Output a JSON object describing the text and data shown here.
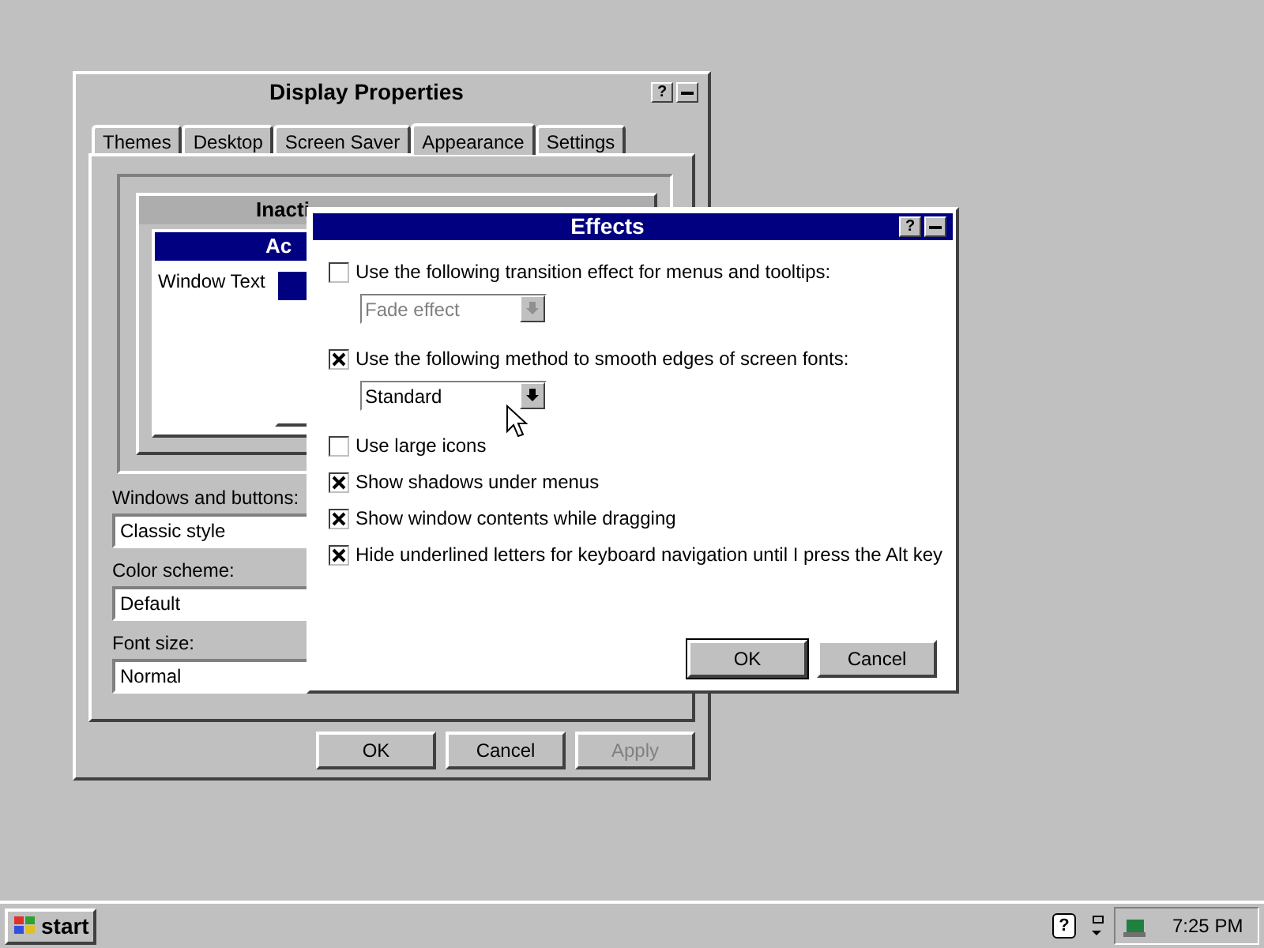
{
  "display_properties": {
    "title": "Display Properties",
    "help_button": "?",
    "tabs": [
      {
        "label": "Themes",
        "selected": false
      },
      {
        "label": "Desktop",
        "selected": false
      },
      {
        "label": "Screen Saver",
        "selected": false
      },
      {
        "label": "Appearance",
        "selected": true
      },
      {
        "label": "Settings",
        "selected": false
      }
    ],
    "preview": {
      "inactive_title": "Inacti",
      "active_title": "Ac",
      "window_text": "Window Text"
    },
    "fields": [
      {
        "label": "Windows and buttons:",
        "value": "Classic style"
      },
      {
        "label": "Color scheme:",
        "value": "Default"
      },
      {
        "label": "Font size:",
        "value": "Normal"
      }
    ],
    "buttons": [
      {
        "label": "OK",
        "disabled": false
      },
      {
        "label": "Cancel",
        "disabled": false
      },
      {
        "label": "Apply",
        "disabled": true
      }
    ]
  },
  "effects": {
    "title": "Effects",
    "help_button": "?",
    "options": [
      {
        "label": "Use the following transition effect for menus and tooltips:",
        "checked": false,
        "dropdown": {
          "value": "Fade effect",
          "disabled": true
        }
      },
      {
        "label": "Use the following method to smooth edges of screen fonts:",
        "checked": true,
        "dropdown": {
          "value": "Standard",
          "disabled": false
        }
      },
      {
        "label": "Use large icons",
        "checked": false
      },
      {
        "label": "Show shadows under menus",
        "checked": true
      },
      {
        "label": "Show window contents while dragging",
        "checked": true
      },
      {
        "label": "Hide underlined letters for keyboard navigation until I press the Alt key",
        "checked": true
      }
    ],
    "buttons": [
      {
        "label": "OK",
        "default": true
      },
      {
        "label": "Cancel",
        "default": false
      }
    ]
  },
  "taskbar": {
    "start": "start",
    "tray_help": "?",
    "clock": "7:25 PM"
  }
}
